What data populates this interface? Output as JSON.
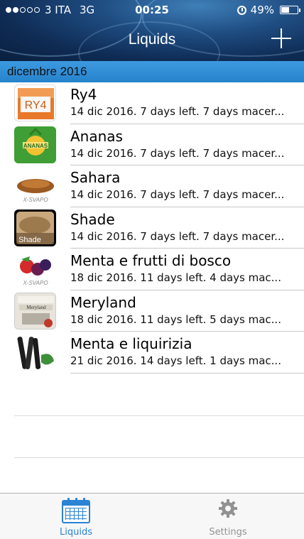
{
  "status_bar": {
    "carrier": "3 ITA",
    "network": "3G",
    "time": "00:25",
    "battery": "49%",
    "battery_level": 0.49,
    "signal_bars": 2
  },
  "nav": {
    "title": "Liquids",
    "add_icon": "plus-icon"
  },
  "section": {
    "title": "dicembre 2016"
  },
  "items": [
    {
      "name": "Ry4",
      "detail": "14 dic 2016. 7 days left. 7 days macer...",
      "thumb_label": "RY4"
    },
    {
      "name": "Ananas",
      "detail": "14 dic 2016. 7 days left. 7 days macer...",
      "thumb_label": "ANANAS"
    },
    {
      "name": "Sahara",
      "detail": "14 dic 2016. 7 days left. 7 days macer...",
      "thumb_label": "X-SVAPO"
    },
    {
      "name": "Shade",
      "detail": "14 dic 2016. 7 days left. 7 days macer...",
      "thumb_label": "Shade"
    },
    {
      "name": "Menta e frutti di bosco",
      "detail": "18 dic 2016. 11 days left. 4 days mac...",
      "thumb_label": "X-SVAPO"
    },
    {
      "name": "Meryland",
      "detail": "18 dic 2016. 11 days left. 5 days mac...",
      "thumb_label": "Meryland"
    },
    {
      "name": "Menta e liquirizia",
      "detail": "21 dic 2016. 14 days left. 1 days mac...",
      "thumb_label": ""
    }
  ],
  "tabs": [
    {
      "label": "Liquids",
      "icon": "calendar-icon",
      "active": true
    },
    {
      "label": "Settings",
      "icon": "gear-icon",
      "active": false
    }
  ],
  "colors": {
    "accent": "#2a83d4",
    "section_header": "#2583cc",
    "inactive_tab": "#929292"
  }
}
